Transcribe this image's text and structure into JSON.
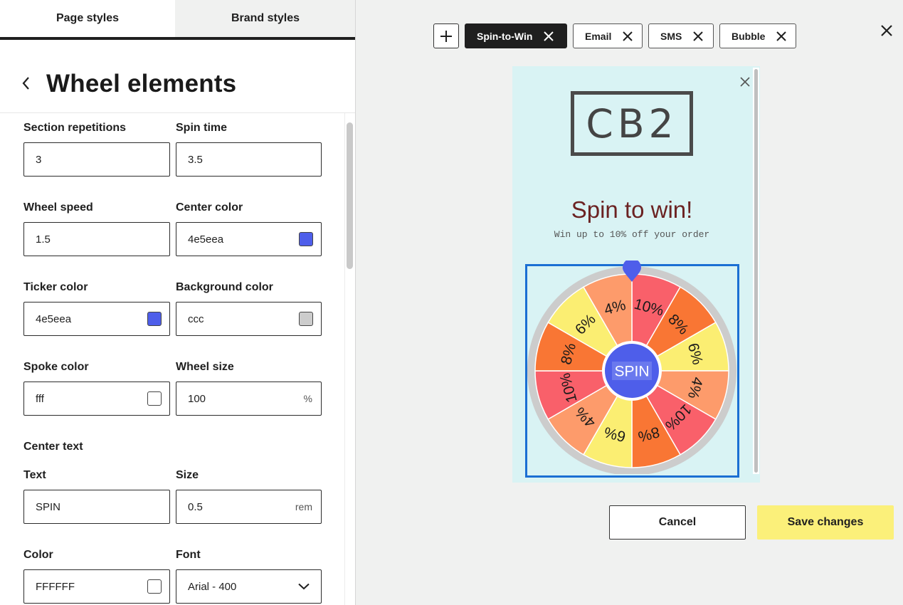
{
  "tabs": [
    {
      "label": "Page styles",
      "active": true
    },
    {
      "label": "Brand styles",
      "active": false
    }
  ],
  "panel": {
    "title": "Wheel elements"
  },
  "fields": {
    "section_repetitions": {
      "label": "Section repetitions",
      "value": "3"
    },
    "spin_time": {
      "label": "Spin time",
      "value": "3.5"
    },
    "wheel_speed": {
      "label": "Wheel speed",
      "value": "1.5"
    },
    "center_color": {
      "label": "Center color",
      "value": "4e5eea",
      "swatch": "#4e5eea"
    },
    "ticker_color": {
      "label": "Ticker color",
      "value": "4e5eea",
      "swatch": "#4e5eea"
    },
    "background_color": {
      "label": "Background color",
      "value": "ccc",
      "swatch": "#cccccc"
    },
    "spoke_color": {
      "label": "Spoke color",
      "value": "fff",
      "swatch": "#ffffff"
    },
    "wheel_size": {
      "label": "Wheel size",
      "value": "100",
      "unit": "%"
    },
    "center_text_section": "Center text",
    "text": {
      "label": "Text",
      "value": "SPIN"
    },
    "size": {
      "label": "Size",
      "value": "0.5",
      "unit": "rem"
    },
    "color": {
      "label": "Color",
      "value": "FFFFFF",
      "swatch": "#ffffff"
    },
    "font": {
      "label": "Font",
      "value": "Arial - 400"
    }
  },
  "chips": [
    {
      "label": "Spin-to-Win",
      "active": true
    },
    {
      "label": "Email",
      "active": false
    },
    {
      "label": "SMS",
      "active": false
    },
    {
      "label": "Bubble",
      "active": false
    }
  ],
  "preview": {
    "logo": "CB2",
    "headline": "Spin to win!",
    "subhead": "Win up to 10% off your order",
    "center_label": "SPIN",
    "segments": [
      "10%",
      "8%",
      "6%",
      "4%",
      "10%",
      "8%",
      "6%",
      "4%",
      "10%",
      "8%",
      "6%",
      "4%"
    ],
    "segment_colors": [
      "#f9606a",
      "#f97634",
      "#fbee72",
      "#fd9b6b"
    ],
    "rim_color": "#cccccc",
    "ticker_color": "#4e5eea",
    "center_color": "#4e5eea"
  },
  "actions": {
    "cancel": "Cancel",
    "save": "Save changes"
  }
}
